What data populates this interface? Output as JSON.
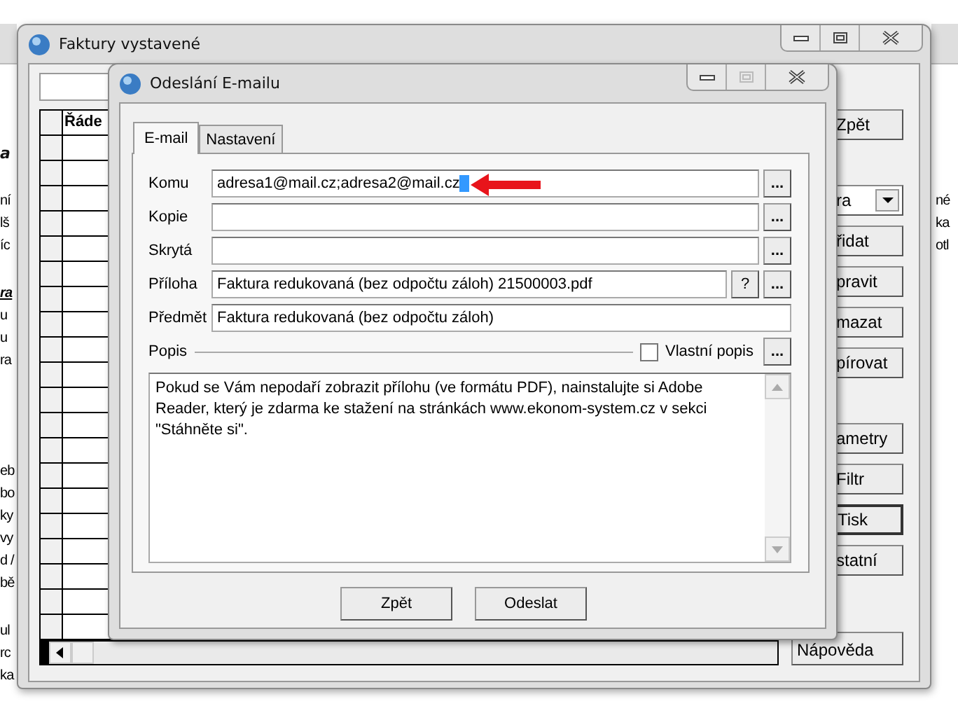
{
  "background_windows": [
    {
      "groups": [
        [
          {
            "text": "a",
            "kind": "title"
          }
        ],
        [
          {
            "text": "ní",
            "kind": "line"
          },
          {
            "text": "lš",
            "kind": "line"
          },
          {
            "text": "íc",
            "kind": "line"
          }
        ],
        [
          {
            "text": "ra",
            "kind": "section"
          },
          {
            "text": "u",
            "kind": "line"
          },
          {
            "text": "u",
            "kind": "line"
          },
          {
            "text": "ra",
            "kind": "line"
          }
        ],
        [
          {
            "text": "eb",
            "kind": "line"
          },
          {
            "text": "bo",
            "kind": "line"
          },
          {
            "text": "ky",
            "kind": "line"
          },
          {
            "text": "vy",
            "kind": "line"
          },
          {
            "text": "d /",
            "kind": "line"
          },
          {
            "text": "bě",
            "kind": "line"
          }
        ],
        [
          {
            "text": "ul",
            "kind": "line"
          },
          {
            "text": "rc",
            "kind": "line"
          },
          {
            "text": "ka",
            "kind": "line"
          }
        ]
      ]
    },
    {
      "groups": [
        [
          {
            "text": "né",
            "kind": "line"
          },
          {
            "text": "ka",
            "kind": "line"
          },
          {
            "text": "otl",
            "kind": "line"
          }
        ]
      ]
    }
  ],
  "main_window": {
    "title": "Faktury vystavené",
    "table": {
      "columns": [
        "Řáde"
      ]
    },
    "button_groups": [
      [
        {
          "label": "Zpět",
          "kind": "button",
          "default": false
        }
      ],
      [
        {
          "label": "ra",
          "kind": "dropdown",
          "default": false
        },
        {
          "label": "řidat",
          "kind": "button",
          "default": false
        },
        {
          "label": "pravit",
          "kind": "button",
          "default": false
        },
        {
          "label": "mazat",
          "kind": "button",
          "default": false
        },
        {
          "label": "pírovat",
          "kind": "button",
          "default": false
        }
      ],
      [
        {
          "label": "ametry",
          "kind": "button",
          "default": false
        },
        {
          "label": "Filtr",
          "kind": "button",
          "default": false
        },
        {
          "label": "Tisk",
          "kind": "button",
          "default": true
        },
        {
          "label": "statní",
          "kind": "button",
          "default": false
        }
      ],
      [
        {
          "label": "Nápověda",
          "kind": "wide",
          "default": false
        }
      ]
    ]
  },
  "dialog": {
    "title": "Odeslání E-mailu",
    "tabs": [
      {
        "label": "E-mail",
        "selected": true
      },
      {
        "label": "Nastavení",
        "selected": false
      }
    ],
    "fields": [
      {
        "label": "Komu",
        "value": "adresa1@mail.cz;adresa2@mail.cz",
        "selection": true,
        "buttons": [
          "..."
        ]
      },
      {
        "label": "Kopie",
        "selection": false,
        "buttons": [
          "..."
        ]
      },
      {
        "label": "Skrytá",
        "selection": false,
        "buttons": [
          "..."
        ]
      },
      {
        "label": "Příloha",
        "value": "Faktura redukovaná (bez odpočtu záloh) 21500003.pdf",
        "selection": false,
        "buttons": [
          "?",
          "..."
        ]
      },
      {
        "label": "Předmět",
        "value": "Faktura redukovaná (bez odpočtu záloh)",
        "selection": false
      }
    ],
    "description": {
      "label": "Popis",
      "custom": {
        "label": "Vlastní popis",
        "checked": false
      },
      "button": "...",
      "text": "Pokud se Vám nepodaří zobrazit přílohu (ve formátu PDF), nainstalujte si Adobe Reader, který je zdarma ke stažení na stránkách www.ekonom-system.cz v sekci \"Stáhněte si\"."
    },
    "annotation": {
      "kind": "arrow"
    },
    "buttons": [
      "Zpět",
      "Odeslat"
    ]
  }
}
